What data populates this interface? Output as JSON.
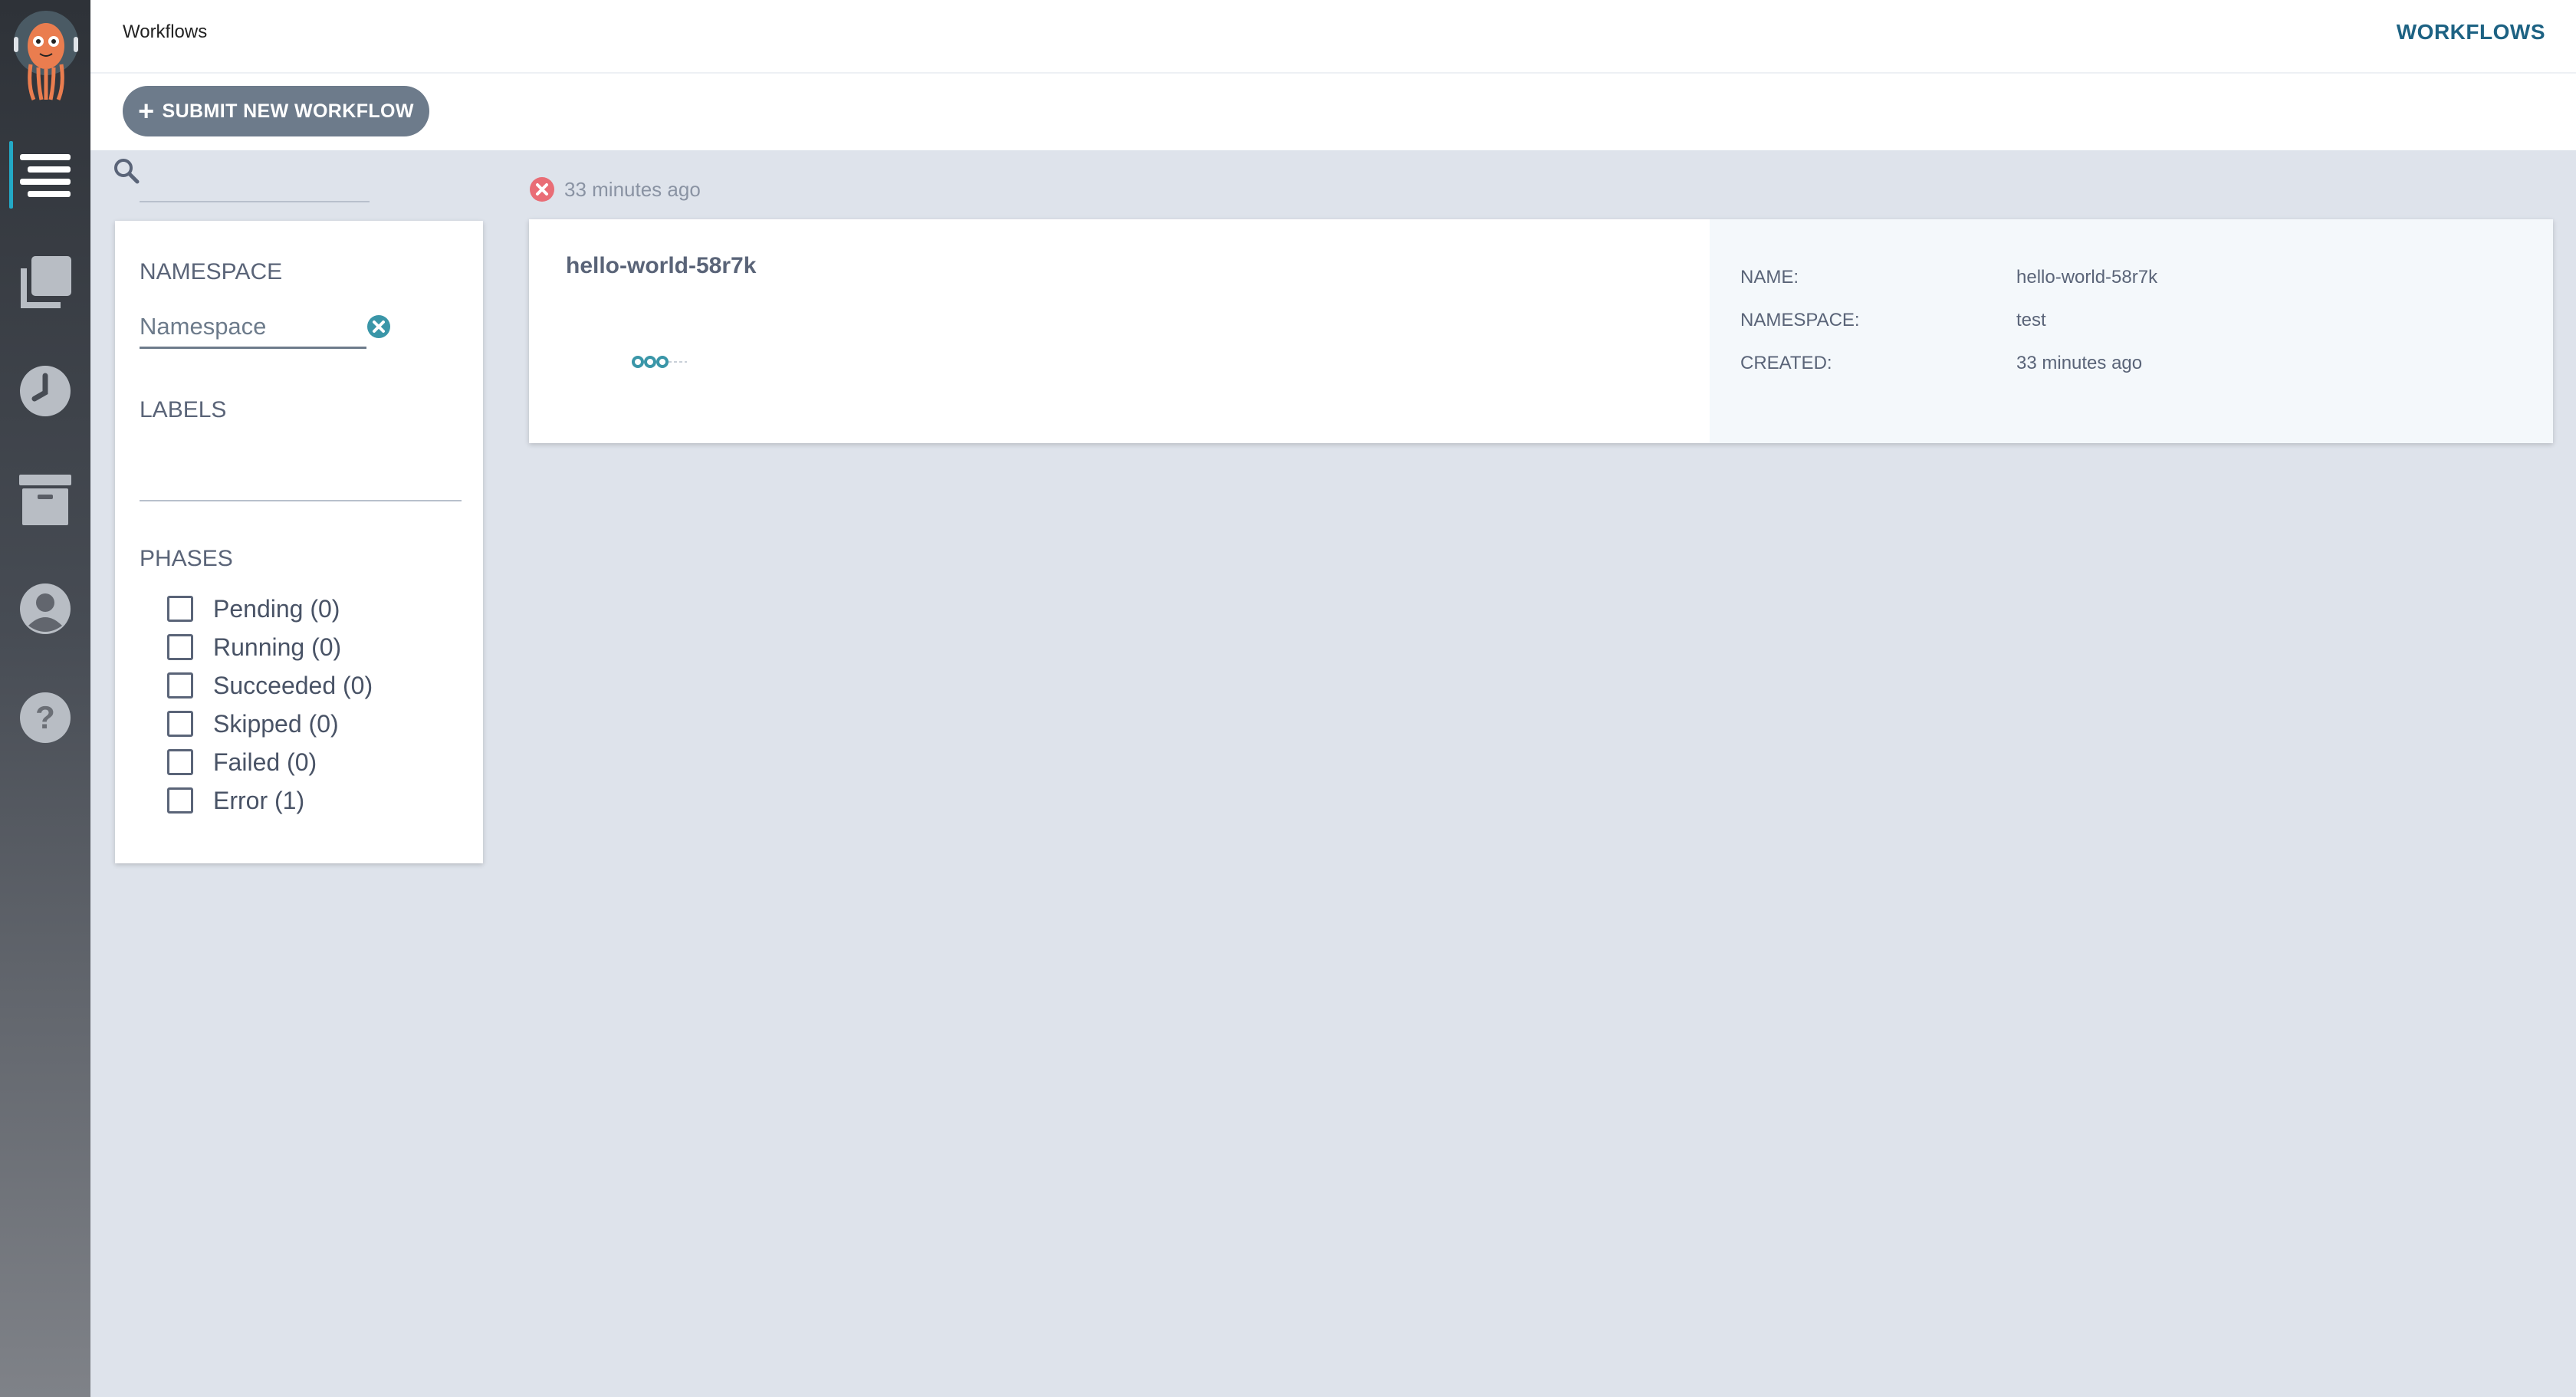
{
  "header": {
    "title": "Workflows",
    "top_link": "WORKFLOWS"
  },
  "toolbar": {
    "submit_label": "SUBMIT NEW WORKFLOW"
  },
  "sidebar": {
    "items": [
      {
        "name": "workflows",
        "icon": "list-icon",
        "active": true
      },
      {
        "name": "workflow-templates",
        "icon": "copy-icon",
        "active": false
      },
      {
        "name": "cron-workflows",
        "icon": "clock-icon",
        "active": false
      },
      {
        "name": "archived-workflows",
        "icon": "archive-icon",
        "active": false
      },
      {
        "name": "user",
        "icon": "user-icon",
        "active": false
      },
      {
        "name": "help",
        "icon": "help-icon",
        "active": false
      }
    ]
  },
  "search": {
    "value": "",
    "placeholder": ""
  },
  "filters": {
    "namespace_heading": "NAMESPACE",
    "namespace_placeholder": "Namespace",
    "labels_heading": "LABELS",
    "phases_heading": "PHASES",
    "phases": [
      {
        "label": "Pending (0)",
        "checked": false
      },
      {
        "label": "Running (0)",
        "checked": false
      },
      {
        "label": "Succeeded (0)",
        "checked": false
      },
      {
        "label": "Skipped (0)",
        "checked": false
      },
      {
        "label": "Failed (0)",
        "checked": false
      },
      {
        "label": "Error (1)",
        "checked": false
      }
    ]
  },
  "workflow": {
    "status_time": "33 minutes ago",
    "status_color": "#e96d76",
    "name": "hello-world-58r7k",
    "meta": {
      "name_label": "NAME:",
      "name_value": "hello-world-58r7k",
      "namespace_label": "NAMESPACE:",
      "namespace_value": "test",
      "created_label": "CREATED:",
      "created_value": "33 minutes ago"
    }
  },
  "colors": {
    "accent": "#23a9c6",
    "link": "#1d6283",
    "button": "#6d7b8b",
    "error": "#e96d76"
  }
}
